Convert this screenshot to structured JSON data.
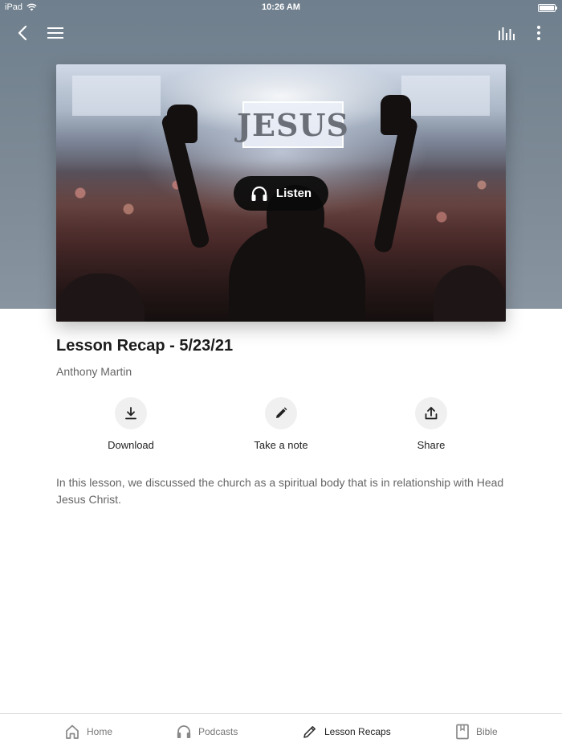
{
  "status_bar": {
    "device": "iPad",
    "time": "10:26 AM"
  },
  "nav": {
    "back_icon": "chevron-left-icon",
    "menu_icon": "hamburger-icon",
    "equalizer_icon": "equalizer-icon",
    "more_icon": "more-vertical-icon"
  },
  "cover": {
    "sign_text": "JESUS",
    "listen_label": "Listen"
  },
  "lesson": {
    "title": "Lesson Recap - 5/23/21",
    "author": "Anthony Martin",
    "description": "In this lesson, we discussed the church as a spiritual body that is in relationship with Head Jesus Christ."
  },
  "actions": [
    {
      "label": "Download",
      "icon": "download-icon"
    },
    {
      "label": "Take a note",
      "icon": "pencil-icon"
    },
    {
      "label": "Share",
      "icon": "share-icon"
    }
  ],
  "tabs": [
    {
      "label": "Home",
      "icon": "home-icon"
    },
    {
      "label": "Podcasts",
      "icon": "headphones-icon"
    },
    {
      "label": "Lesson Recaps",
      "icon": "pencil-icon",
      "active": true
    },
    {
      "label": "Bible",
      "icon": "book-icon"
    }
  ],
  "colors": {
    "hero": "#7d8a96",
    "listen_button": "#0a0a0a",
    "action_circle": "#f0f0f0"
  }
}
